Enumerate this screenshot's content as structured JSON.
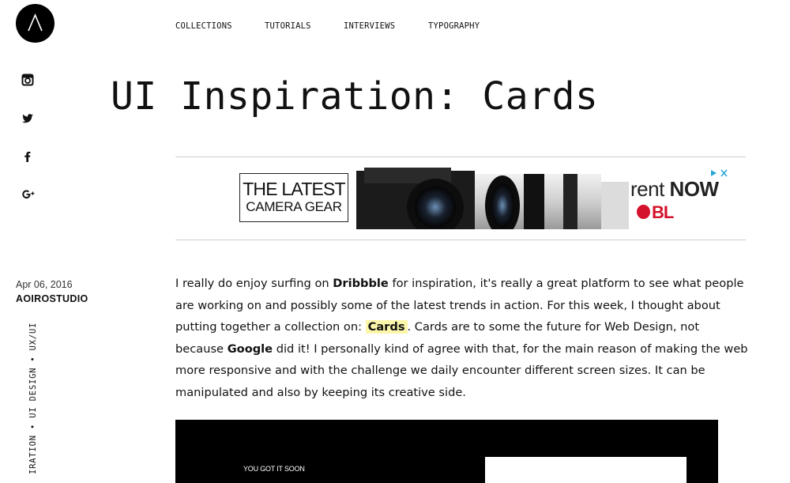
{
  "nav": {
    "items": [
      "COLLECTIONS",
      "TUTORIALS",
      "INTERVIEWS",
      "TYPOGRAPHY"
    ]
  },
  "social": [
    "instagram-icon",
    "twitter-icon",
    "facebook-icon",
    "google-plus-icon"
  ],
  "page_title": "UI Inspiration: Cards",
  "ad": {
    "line1": "THE LATEST",
    "line2": "CAMERA GEAR",
    "rent": "rent",
    "now": "NOW",
    "brand": "BL"
  },
  "meta": {
    "date": "Apr 06, 2016",
    "author": "AOIROSTUDIO",
    "tags": "IRATION • UI DESIGN • UX/UI"
  },
  "article": {
    "p1": "I really do enjoy surfing on ",
    "dribbble": "Dribbble",
    "p2": " for inspiration, it's really a great platform to see what people are working on and possibly some of the latest trends in action. For this week, I thought about putting together a collection on: ",
    "cards": "Cards",
    "p3": ". Cards are to some the future for Web Design, not because ",
    "google": "Google",
    "p4": " did it! I personally kind of agree with that, for the main reason of making the web more responsive and with the challenge we daily encounter different screen sizes. It can be manipulated and also by keeping its creative side."
  },
  "card_image": {
    "caption": "YOU GOT IT SOON"
  },
  "colors": {
    "highlight": "#fbf6a9",
    "brand_red": "#d4122b",
    "text": "#111111"
  }
}
